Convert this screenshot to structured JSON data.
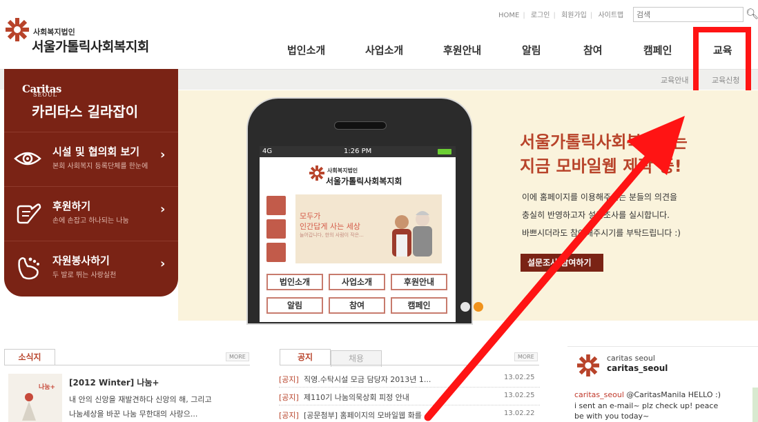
{
  "header": {
    "logo_sub": "사회복지법인",
    "logo_name": "서울가톨릭사회복지회",
    "util_links": [
      "HOME",
      "로그인",
      "회원가입",
      "사이트맵"
    ],
    "search_placeholder": "검색",
    "nav": [
      "법인소개",
      "사업소개",
      "후원안내",
      "알림",
      "참여",
      "캠페인",
      "교육"
    ],
    "subnav": [
      "교육안내",
      "교육신청"
    ]
  },
  "guide": {
    "brand": "Caritas",
    "brand_small": "SEOUL",
    "title": "카리타스 길라잡이",
    "items": [
      {
        "label": "시설 및 협의회 보기",
        "sub": "본회 사회복지 등록단체를 한눈에",
        "icon": "eye-icon"
      },
      {
        "label": "후원하기",
        "sub": "손에 손잡고 하나되는 나눔",
        "icon": "hand-icon"
      },
      {
        "label": "자원봉사하기",
        "sub": "두 발로 뛰는 사랑실천",
        "icon": "foot-icon"
      }
    ]
  },
  "hero": {
    "phone": {
      "network": "4G",
      "time": "1:26 PM",
      "logo_sub": "사회복지법인",
      "logo_name": "서울가톨릭사회복지회",
      "banner_title_1": "모두가",
      "banner_title_2": "인간답게 사는 세상",
      "banner_sub": "늘어갑니다, 한의 사람이 작은...",
      "buttons": [
        "법인소개",
        "사업소개",
        "후원안내",
        "알림",
        "참여",
        "캠페인"
      ]
    },
    "title_1": "서울가톨릭사회복지회는",
    "title_2": "지금 모바일웹 제작 중!",
    "desc_1": "이에 홈페이지를 이용해주시는 분들의 의견을",
    "desc_2": "충실히 반영하고자 설문조사를 실시합니다.",
    "desc_3": "바쁘시더라도 참여해주시기를 부탁드립니다 :)",
    "cta": "설문조사 참여하기"
  },
  "news": {
    "tab": "소식지",
    "more": "MORE",
    "title": "[2012 Winter] 나눔+",
    "body_1": "내 안의 신앙을 재발견하다 신앙의 해, 그리고",
    "body_2": "나눔세상을 바꾼 나눔 무한대의 사랑으...",
    "thumb_label": "나눔+"
  },
  "notices": {
    "tabs": [
      "공지",
      "채용"
    ],
    "more": "MORE",
    "rows": [
      {
        "cat": "[공지]",
        "text": "직영.수탁시설 모금 담당자 2013년 1...",
        "date": "13.02.25"
      },
      {
        "cat": "[공지]",
        "text": "제110기 나눔의묵상회 피정 안내",
        "date": "13.02.25"
      },
      {
        "cat": "[공지]",
        "text": "[공문첨부] 홈페이지의 모바일웹 화를 ...",
        "date": "13.02.22"
      }
    ]
  },
  "twitter": {
    "name": "caritas seoul",
    "handle": "caritas_seoul",
    "tweet_user": "caritas_seoul",
    "tweet_1": "@CaritasManila HELLO :)",
    "tweet_2": "i sent an e-mail~ plz check up! peace",
    "tweet_3": "be with you today~"
  },
  "colors": {
    "brand_dark": "#7a2315",
    "brand_accent": "#b8432a",
    "highlight": "#ff1414",
    "hero_bg": "#faf3dc"
  }
}
